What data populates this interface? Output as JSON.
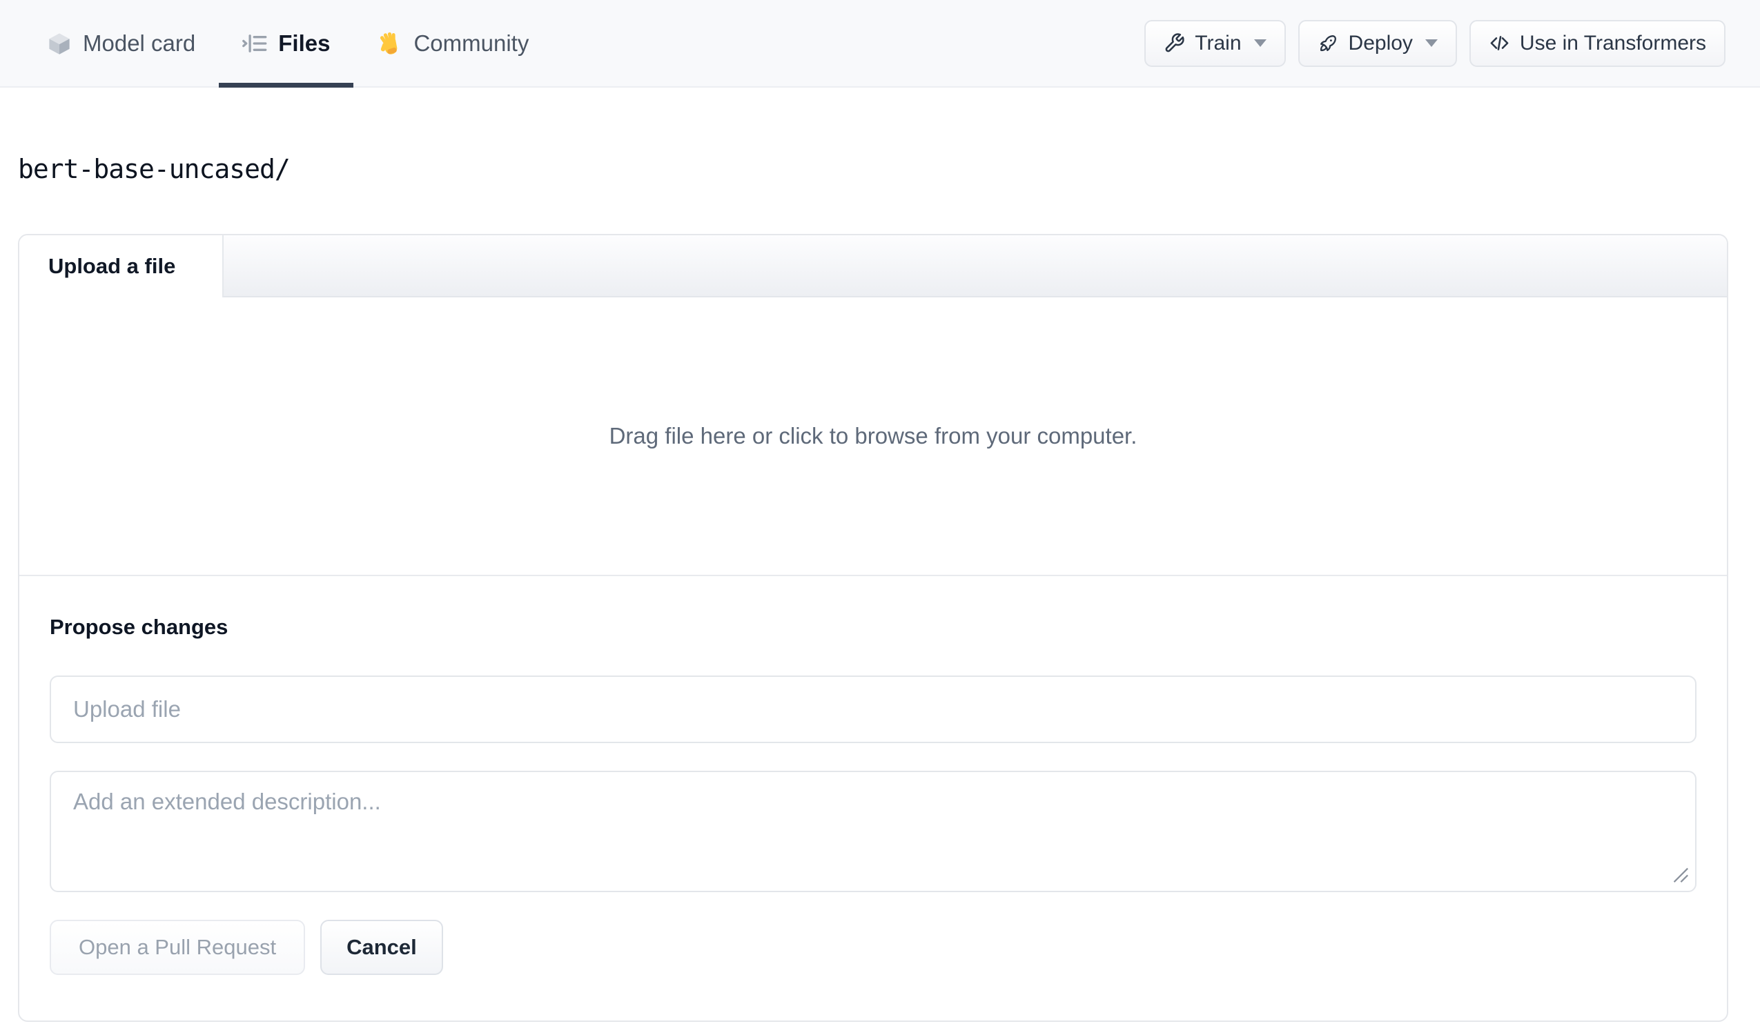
{
  "nav": {
    "tabs": [
      {
        "label": "Model card",
        "icon": "cube-icon",
        "active": false
      },
      {
        "label": "Files",
        "icon": "files-list-icon",
        "active": true
      },
      {
        "label": "Community",
        "icon": "waving-hand-icon",
        "active": false
      }
    ],
    "actions": [
      {
        "label": "Train",
        "icon": "wrench-icon",
        "has_dropdown": true
      },
      {
        "label": "Deploy",
        "icon": "rocket-icon",
        "has_dropdown": true
      },
      {
        "label": "Use in Transformers",
        "icon": "code-icon",
        "has_dropdown": false
      }
    ]
  },
  "breadcrumb": {
    "path": "bert-base-uncased/"
  },
  "upload_card": {
    "tab_label": "Upload a file",
    "dropzone_text": "Drag file here or click to browse from your computer.",
    "propose": {
      "heading": "Propose changes",
      "filename_placeholder": "Upload file",
      "description_placeholder": "Add an extended description...",
      "submit_label": "Open a Pull Request",
      "cancel_label": "Cancel"
    }
  },
  "colors": {
    "active_tab_underline": "#364153",
    "nav_background": "#f8f9fb",
    "card_border": "#e5e7eb",
    "placeholder_text": "#9aa4b1",
    "muted_text": "#5e6979",
    "disabled_button_text": "#99a2ae",
    "hand_emoji_yellow": "#FFC83D"
  }
}
